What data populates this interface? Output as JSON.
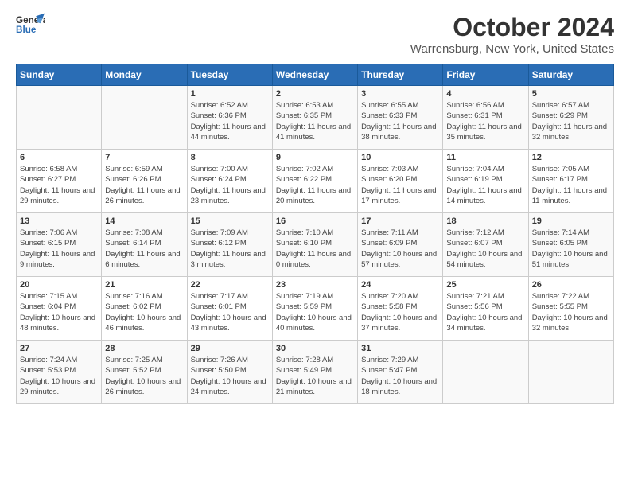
{
  "header": {
    "logo_line1": "General",
    "logo_line2": "Blue",
    "month": "October 2024",
    "location": "Warrensburg, New York, United States"
  },
  "days_of_week": [
    "Sunday",
    "Monday",
    "Tuesday",
    "Wednesday",
    "Thursday",
    "Friday",
    "Saturday"
  ],
  "weeks": [
    [
      {
        "day": "",
        "sunrise": "",
        "sunset": "",
        "daylight": ""
      },
      {
        "day": "",
        "sunrise": "",
        "sunset": "",
        "daylight": ""
      },
      {
        "day": "1",
        "sunrise": "Sunrise: 6:52 AM",
        "sunset": "Sunset: 6:36 PM",
        "daylight": "Daylight: 11 hours and 44 minutes."
      },
      {
        "day": "2",
        "sunrise": "Sunrise: 6:53 AM",
        "sunset": "Sunset: 6:35 PM",
        "daylight": "Daylight: 11 hours and 41 minutes."
      },
      {
        "day": "3",
        "sunrise": "Sunrise: 6:55 AM",
        "sunset": "Sunset: 6:33 PM",
        "daylight": "Daylight: 11 hours and 38 minutes."
      },
      {
        "day": "4",
        "sunrise": "Sunrise: 6:56 AM",
        "sunset": "Sunset: 6:31 PM",
        "daylight": "Daylight: 11 hours and 35 minutes."
      },
      {
        "day": "5",
        "sunrise": "Sunrise: 6:57 AM",
        "sunset": "Sunset: 6:29 PM",
        "daylight": "Daylight: 11 hours and 32 minutes."
      }
    ],
    [
      {
        "day": "6",
        "sunrise": "Sunrise: 6:58 AM",
        "sunset": "Sunset: 6:27 PM",
        "daylight": "Daylight: 11 hours and 29 minutes."
      },
      {
        "day": "7",
        "sunrise": "Sunrise: 6:59 AM",
        "sunset": "Sunset: 6:26 PM",
        "daylight": "Daylight: 11 hours and 26 minutes."
      },
      {
        "day": "8",
        "sunrise": "Sunrise: 7:00 AM",
        "sunset": "Sunset: 6:24 PM",
        "daylight": "Daylight: 11 hours and 23 minutes."
      },
      {
        "day": "9",
        "sunrise": "Sunrise: 7:02 AM",
        "sunset": "Sunset: 6:22 PM",
        "daylight": "Daylight: 11 hours and 20 minutes."
      },
      {
        "day": "10",
        "sunrise": "Sunrise: 7:03 AM",
        "sunset": "Sunset: 6:20 PM",
        "daylight": "Daylight: 11 hours and 17 minutes."
      },
      {
        "day": "11",
        "sunrise": "Sunrise: 7:04 AM",
        "sunset": "Sunset: 6:19 PM",
        "daylight": "Daylight: 11 hours and 14 minutes."
      },
      {
        "day": "12",
        "sunrise": "Sunrise: 7:05 AM",
        "sunset": "Sunset: 6:17 PM",
        "daylight": "Daylight: 11 hours and 11 minutes."
      }
    ],
    [
      {
        "day": "13",
        "sunrise": "Sunrise: 7:06 AM",
        "sunset": "Sunset: 6:15 PM",
        "daylight": "Daylight: 11 hours and 9 minutes."
      },
      {
        "day": "14",
        "sunrise": "Sunrise: 7:08 AM",
        "sunset": "Sunset: 6:14 PM",
        "daylight": "Daylight: 11 hours and 6 minutes."
      },
      {
        "day": "15",
        "sunrise": "Sunrise: 7:09 AM",
        "sunset": "Sunset: 6:12 PM",
        "daylight": "Daylight: 11 hours and 3 minutes."
      },
      {
        "day": "16",
        "sunrise": "Sunrise: 7:10 AM",
        "sunset": "Sunset: 6:10 PM",
        "daylight": "Daylight: 11 hours and 0 minutes."
      },
      {
        "day": "17",
        "sunrise": "Sunrise: 7:11 AM",
        "sunset": "Sunset: 6:09 PM",
        "daylight": "Daylight: 10 hours and 57 minutes."
      },
      {
        "day": "18",
        "sunrise": "Sunrise: 7:12 AM",
        "sunset": "Sunset: 6:07 PM",
        "daylight": "Daylight: 10 hours and 54 minutes."
      },
      {
        "day": "19",
        "sunrise": "Sunrise: 7:14 AM",
        "sunset": "Sunset: 6:05 PM",
        "daylight": "Daylight: 10 hours and 51 minutes."
      }
    ],
    [
      {
        "day": "20",
        "sunrise": "Sunrise: 7:15 AM",
        "sunset": "Sunset: 6:04 PM",
        "daylight": "Daylight: 10 hours and 48 minutes."
      },
      {
        "day": "21",
        "sunrise": "Sunrise: 7:16 AM",
        "sunset": "Sunset: 6:02 PM",
        "daylight": "Daylight: 10 hours and 46 minutes."
      },
      {
        "day": "22",
        "sunrise": "Sunrise: 7:17 AM",
        "sunset": "Sunset: 6:01 PM",
        "daylight": "Daylight: 10 hours and 43 minutes."
      },
      {
        "day": "23",
        "sunrise": "Sunrise: 7:19 AM",
        "sunset": "Sunset: 5:59 PM",
        "daylight": "Daylight: 10 hours and 40 minutes."
      },
      {
        "day": "24",
        "sunrise": "Sunrise: 7:20 AM",
        "sunset": "Sunset: 5:58 PM",
        "daylight": "Daylight: 10 hours and 37 minutes."
      },
      {
        "day": "25",
        "sunrise": "Sunrise: 7:21 AM",
        "sunset": "Sunset: 5:56 PM",
        "daylight": "Daylight: 10 hours and 34 minutes."
      },
      {
        "day": "26",
        "sunrise": "Sunrise: 7:22 AM",
        "sunset": "Sunset: 5:55 PM",
        "daylight": "Daylight: 10 hours and 32 minutes."
      }
    ],
    [
      {
        "day": "27",
        "sunrise": "Sunrise: 7:24 AM",
        "sunset": "Sunset: 5:53 PM",
        "daylight": "Daylight: 10 hours and 29 minutes."
      },
      {
        "day": "28",
        "sunrise": "Sunrise: 7:25 AM",
        "sunset": "Sunset: 5:52 PM",
        "daylight": "Daylight: 10 hours and 26 minutes."
      },
      {
        "day": "29",
        "sunrise": "Sunrise: 7:26 AM",
        "sunset": "Sunset: 5:50 PM",
        "daylight": "Daylight: 10 hours and 24 minutes."
      },
      {
        "day": "30",
        "sunrise": "Sunrise: 7:28 AM",
        "sunset": "Sunset: 5:49 PM",
        "daylight": "Daylight: 10 hours and 21 minutes."
      },
      {
        "day": "31",
        "sunrise": "Sunrise: 7:29 AM",
        "sunset": "Sunset: 5:47 PM",
        "daylight": "Daylight: 10 hours and 18 minutes."
      },
      {
        "day": "",
        "sunrise": "",
        "sunset": "",
        "daylight": ""
      },
      {
        "day": "",
        "sunrise": "",
        "sunset": "",
        "daylight": ""
      }
    ]
  ]
}
